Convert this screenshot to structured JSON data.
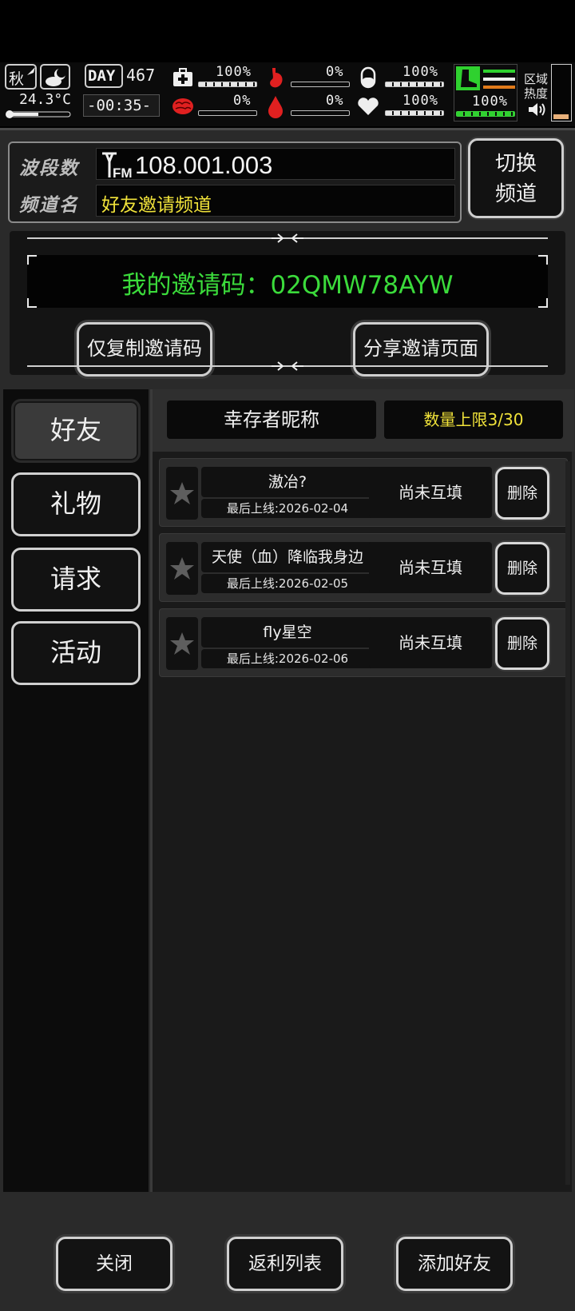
{
  "status": {
    "season": "秋",
    "temperature": "24.3°C",
    "day_label": "DAY",
    "day_number": "467",
    "clock": "-00:35-",
    "stats": [
      {
        "icon": "medkit-icon",
        "value": "100%",
        "level": 1.0
      },
      {
        "icon": "stomach-icon",
        "value": "0%",
        "level": 0.0
      },
      {
        "icon": "pill-icon",
        "value": "100%",
        "level": 1.0
      },
      {
        "icon": "brain-icon",
        "value": "0%",
        "level": 0.0
      },
      {
        "icon": "blood-drop-icon",
        "value": "0%",
        "level": 0.0
      },
      {
        "icon": "heart-icon",
        "value": "100%",
        "level": 1.0
      }
    ],
    "stamina": {
      "icon": "boot-icon",
      "value": "100%",
      "level": 1.0
    },
    "zone_heat_label_1": "区域",
    "zone_heat_label_2": "热度"
  },
  "radio": {
    "band_label": "波段数",
    "band_value": "108.001.003",
    "channel_label": "频道名",
    "channel_value": "好友邀请频道",
    "switch_line1": "切换",
    "switch_line2": "频道"
  },
  "invite": {
    "code_text": "我的邀请码：02QMW78AYW",
    "copy_button": "仅复制邀请码",
    "share_button": "分享邀请页面"
  },
  "tabs": [
    {
      "label": "好友",
      "active": true
    },
    {
      "label": "礼物",
      "active": false
    },
    {
      "label": "请求",
      "active": false
    },
    {
      "label": "活动",
      "active": false
    }
  ],
  "list_header": {
    "name_col": "幸存者昵称",
    "limit": "数量上限3/30"
  },
  "friends": [
    {
      "nickname": "滶冶?",
      "last_online": "最后上线:2026-02-04",
      "status": "尚未互填",
      "delete": "删除"
    },
    {
      "nickname": "天使（血）降临我身边",
      "last_online": "最后上线:2026-02-05",
      "status": "尚未互填",
      "delete": "删除"
    },
    {
      "nickname": "fly星空",
      "last_online": "最后上线:2026-02-06",
      "status": "尚未互填",
      "delete": "删除"
    }
  ],
  "footer": {
    "close": "关闭",
    "rebate_list": "返利列表",
    "add_friend": "添加好友"
  },
  "colors": {
    "accent_green": "#3bdb3b",
    "accent_yellow": "#f1e33a",
    "status_red": "#e02020",
    "stamina_orange": "#e07a1a"
  }
}
